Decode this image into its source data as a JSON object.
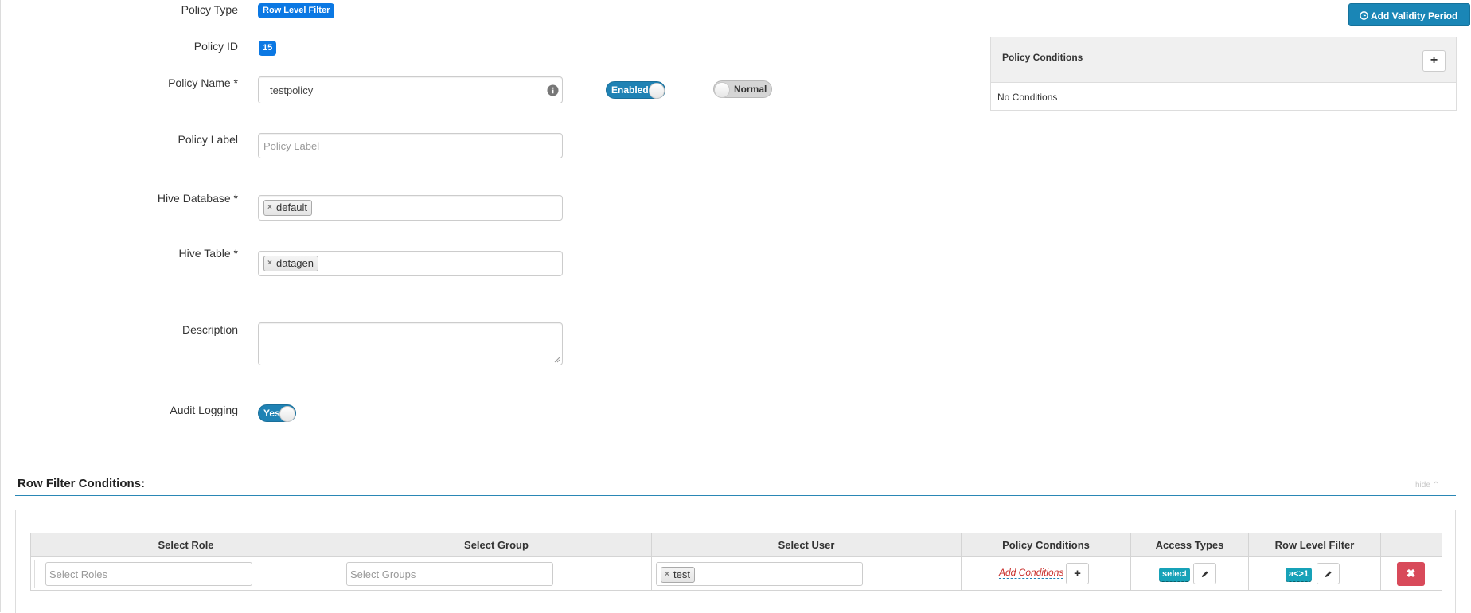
{
  "form": {
    "policy_type_label": "Policy Type",
    "policy_type_value": "Row Level Filter",
    "policy_id_label": "Policy ID",
    "policy_id_value": "15",
    "policy_name_label": "Policy Name *",
    "policy_name_value": "testpolicy",
    "enabled_toggle": "Enabled",
    "normal_toggle": "Normal",
    "policy_label_label": "Policy Label",
    "policy_label_placeholder": "Policy Label",
    "hive_database_label": "Hive Database *",
    "hive_database_values": [
      "default"
    ],
    "hive_table_label": "Hive Table *",
    "hive_table_values": [
      "datagen"
    ],
    "description_label": "Description",
    "description_value": "",
    "audit_logging_label": "Audit Logging",
    "audit_logging_toggle": "Yes"
  },
  "validity": {
    "button_label": "Add Validity Period"
  },
  "policy_conditions_panel": {
    "title": "Policy Conditions",
    "empty_text": "No Conditions"
  },
  "row_filter": {
    "section_title": "Row Filter Conditions:",
    "hide_label": "hide",
    "columns": [
      "Select Role",
      "Select Group",
      "Select User",
      "Policy Conditions",
      "Access Types",
      "Row Level Filter",
      ""
    ],
    "rows": [
      {
        "roles_placeholder": "Select Roles",
        "groups_placeholder": "Select Groups",
        "users": [
          "test"
        ],
        "add_conditions_label": "Add Conditions",
        "access_type": "select",
        "row_filter": "a<>1"
      }
    ]
  },
  "colors": {
    "primary_blue": "#0b78e3",
    "toggle_blue": "#1f82b4",
    "teal": "#17a2b8",
    "danger": "#d84a5a",
    "link_red": "#c9302c"
  }
}
